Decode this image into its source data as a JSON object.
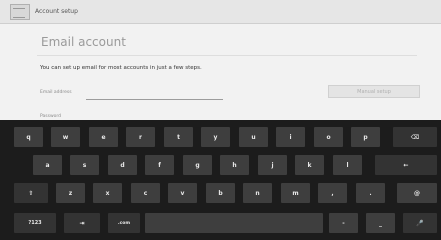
{
  "app": {
    "title": "Account setup"
  },
  "page": {
    "heading": "Email account",
    "intro": "You can set up email for most accounts in just a few steps.",
    "email_label": "Email address",
    "email_value": "",
    "password_label": "Password",
    "manual_setup_label": "Manual setup"
  },
  "keyboard": {
    "row1": [
      "q",
      "w",
      "e",
      "r",
      "t",
      "y",
      "u",
      "i",
      "o",
      "p"
    ],
    "row2": [
      "a",
      "s",
      "d",
      "f",
      "g",
      "h",
      "j",
      "k",
      "l"
    ],
    "row3": [
      "z",
      "x",
      "c",
      "v",
      "b",
      "n",
      "m",
      ",",
      "."
    ],
    "sym_label": "?123",
    "tab_glyph": "⇥",
    "mic_glyph": "🎤",
    "shift_glyph": "⇧",
    "backspace_glyph": "⌫",
    "enter_glyph": "←",
    "at_label": "@",
    "dash_label": "-",
    "underscore_label": "_",
    "dotcom_label": ".com"
  },
  "colors": {
    "keyboard_bg": "#1c1c1c",
    "key_bg": "#3e3e3e",
    "key_text": "#e8e8e8"
  }
}
